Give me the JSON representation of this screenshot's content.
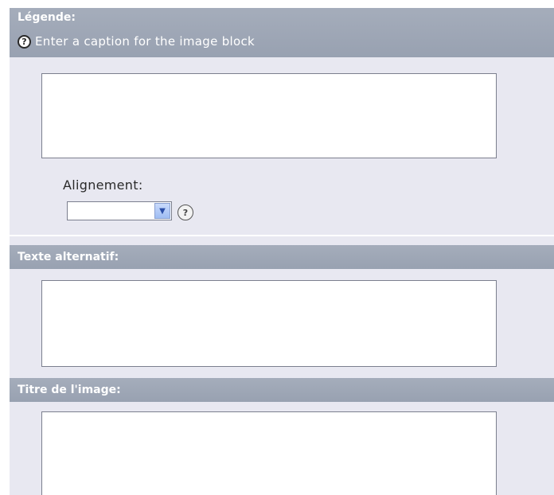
{
  "caption_section": {
    "title": "Légende:",
    "help_text": "Enter a caption for the image block",
    "textarea_value": ""
  },
  "alignment": {
    "label": "Alignement:",
    "selected_value": ""
  },
  "alt_text_section": {
    "title": "Texte alternatif:",
    "textarea_value": ""
  },
  "image_title_section": {
    "title": "Titre de l'image:",
    "textarea_value": ""
  },
  "icons": {
    "help": "question-mark-circle-icon",
    "dropdown": "chevron-down-icon"
  },
  "colors": {
    "header_bg": "#9ea6b6",
    "panel_bg": "#e8e8f1",
    "field_border": "#7b7f8e",
    "dropdown_accent": "#9fbdf3"
  }
}
